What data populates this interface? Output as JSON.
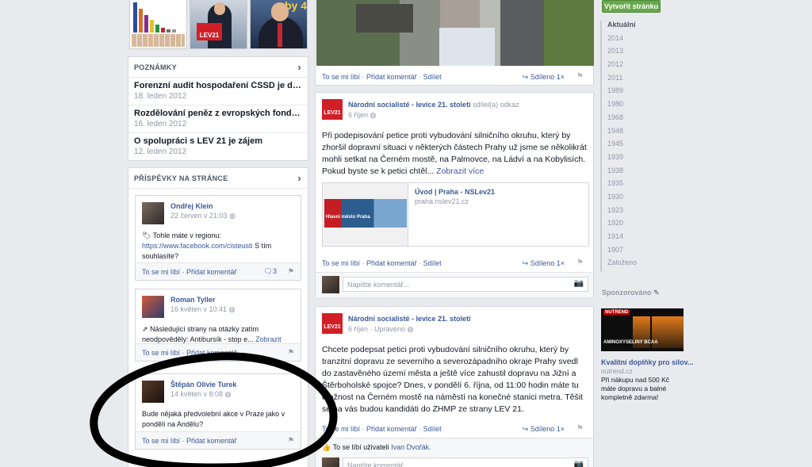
{
  "left": {
    "notes": {
      "header": "POZNÁMKY",
      "items": [
        {
          "title": "Forenzní audit hospodaření ČSSD je dobrý nápad, ...",
          "date": "18. leden 2012"
        },
        {
          "title": "Rozdělování peněz z evropských fondů v Ústeckém...",
          "date": "16. leden 2012"
        },
        {
          "title": "O spolupráci s LEV 21 je zájem",
          "date": "12. leden 2012"
        }
      ]
    },
    "page_posts": {
      "header": "PŘÍSPĚVKY NA STRÁNCE",
      "items": [
        {
          "name": "Ondřej Klein",
          "date": "22 červen v 21:03",
          "text": "Tohle máte v regionu:",
          "link": "https://www.facebook.com/cisteusti",
          "text2": "S tím souhlasíte?",
          "comments": "3"
        },
        {
          "name": "Roman Tyller",
          "date": "16 květen v 10:41",
          "text": "Následující strany na otázky zatím neodpověděly: Antibursík - stop e...",
          "more": "Zobrazit více"
        },
        {
          "name": "Štěpán Olivie Turek",
          "date": "14 květen v 8:08",
          "text": "Bude nějaká předvolební akce v Praze jako v pondělí na Andělu?"
        }
      ],
      "like": "To se mi líbí",
      "comment": "Přidat komentář"
    },
    "photo_overlay_text": "by 4"
  },
  "feed": {
    "like": "To se mi líbí",
    "comment": "Přidat komentář",
    "share": "Sdílet",
    "shared": "Sdíleno 1×",
    "comment_placeholder": "Napište komentář...",
    "logo_text": "LEV21",
    "posts": [
      {
        "author": "Národní socialisté - levice 21. století",
        "suffix": "sdílel(a) odkaz",
        "date": "6 říjen",
        "text": "Při podepisování petice proti vybudování silničního okruhu, který by zhoršil dopravní situaci v některých částech Prahy už jsme se několikrát mohli setkat na Černém mostě, na Palmovce, na Ládví a na Kobylisích. Pokud byste se k petici chtěl...",
        "more": "Zobrazit více",
        "link_title": "Úvod | Praha - NSLev21",
        "link_url": "praha.nslev21.cz",
        "banner_text": "Hlavní město Praha"
      },
      {
        "author": "Národní socialisté - levice 21. století",
        "date": "6 říjen · Upraveno",
        "text": "Chcete podepsat petici proti vybudování silničního okruhu, který by tranzitní dopravu ze severního a severozápadního okraje Prahy svedl do zastavěného území města a ještě více zahustil dopravu na Jižní a Štěrboholské spojce? Dnes, v pondělí 6. října, od 11:00 hodin máte tu možnost na Černém mostě na náměstí na konečné stanici metra. Těšit se na vás budou kandidáti do ZHMP ze strany LEV 21.",
        "likes_prefix": "To se líbí uživateli",
        "likes_user": "Ivan Dvořák."
      }
    ]
  },
  "right": {
    "create_page": "Vytvořit stránku",
    "years": [
      "Aktuální",
      "2014",
      "2013",
      "2012",
      "2011",
      "1989",
      "1980",
      "1968",
      "1948",
      "1945",
      "1939",
      "1938",
      "1935",
      "1930",
      "1923",
      "1920",
      "1914",
      "1907",
      "Založeno"
    ],
    "sponsored": "Sponzorováno",
    "ad": {
      "brand": "NUTREND",
      "img_text": "AMINOXYSELINY BCAA",
      "title": "Kvalitní doplňky pro silov...",
      "domain": "nutrend.cz",
      "text": "Při nákupu nad 500 Kč máte dopravu a balné kompletně zdarma!"
    }
  }
}
